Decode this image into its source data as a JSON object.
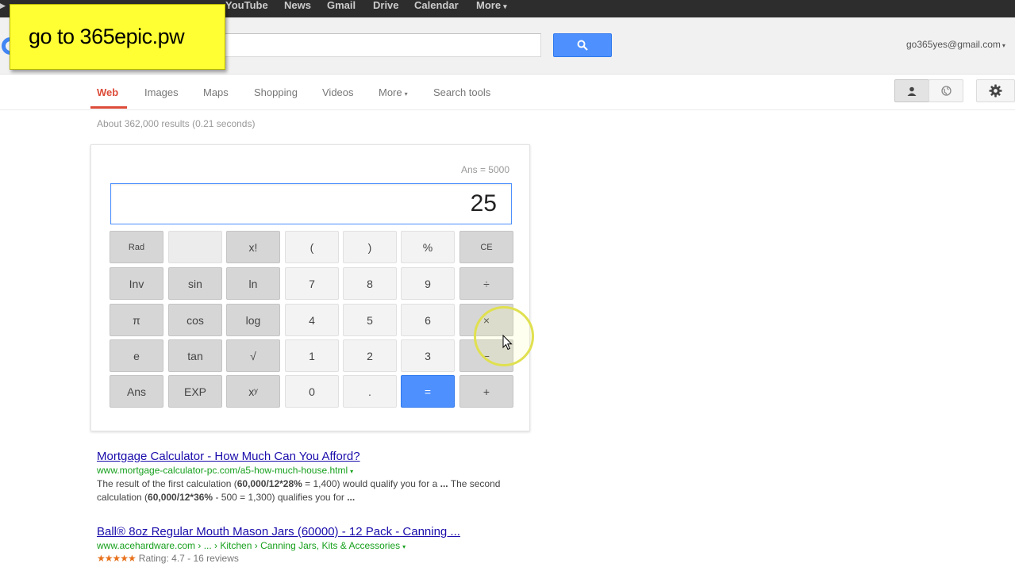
{
  "topbar": {
    "items": [
      "YouTube",
      "News",
      "Gmail",
      "Drive",
      "Calendar",
      "More"
    ]
  },
  "overlay": {
    "text": "go to 365epic.pw"
  },
  "header": {
    "account": "go365yes@gmail.com"
  },
  "tabs": {
    "items": [
      "Web",
      "Images",
      "Maps",
      "Shopping",
      "Videos",
      "More",
      "Search tools"
    ]
  },
  "stats": "About 362,000 results (0.21 seconds)",
  "calculator": {
    "ans": "Ans = 5000",
    "display": "25",
    "keys": [
      "Rad",
      "",
      "x!",
      "(",
      ")",
      "%",
      "CE",
      "Inv",
      "sin",
      "ln",
      "7",
      "8",
      "9",
      "÷",
      "π",
      "cos",
      "log",
      "4",
      "5",
      "6",
      "×",
      "e",
      "tan",
      "√",
      "1",
      "2",
      "3",
      "−",
      "Ans",
      "EXP",
      "xʸ",
      "0",
      ".",
      "=",
      "+"
    ]
  },
  "results": [
    {
      "title": "Mortgage Calculator - How Much Can You Afford?",
      "url": "www.mortgage-calculator-pc.com/a5-how-much-house.html",
      "snippet_a": "The result of the first calculation (",
      "snippet_b": "60,000/12*28%",
      "snippet_c": " = 1,400) would qualify you for a ",
      "snippet_d": "...",
      "snippet_e": " The second calculation (",
      "snippet_f": "60,000/12*36%",
      "snippet_g": " - 500 = 1,300) qualifies you for ",
      "snippet_h": "..."
    },
    {
      "title": "Ball® 8oz Regular Mouth Mason Jars (60000) - 12 Pack - Canning ...",
      "url": "www.acehardware.com › ... › Kitchen › Canning Jars, Kits & Accessories",
      "stars": "★★★★★",
      "rating": "Rating: 4.7 - 16 reviews"
    }
  ],
  "icons": {
    "search": "search-icon",
    "person": "person-icon",
    "globe": "globe-icon",
    "gear": "gear-icon",
    "cursor": "mouse-pointer-icon"
  },
  "colors": {
    "accent_blue": "#4d90fe",
    "tab_red": "#dd4b39",
    "link": "#1a0dab",
    "url_green": "#16a01c",
    "note_yellow": "#ffff33"
  }
}
